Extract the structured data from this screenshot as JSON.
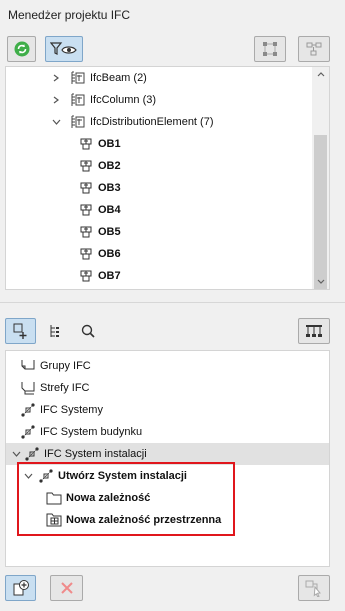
{
  "window": {
    "title": "Menedżer projektu IFC"
  },
  "toolbar_top": {
    "refresh_icon": "refresh-icon",
    "filter_view_icon": "filter-eye-icon",
    "structure_left_icon": "node-structure-icon",
    "structure_right_icon": "node-link-icon"
  },
  "tree_top": {
    "items": [
      {
        "label": "IfcBeam (2)",
        "expanded": false
      },
      {
        "label": "IfcColumn (3)",
        "expanded": false
      },
      {
        "label": "IfcDistributionElement (7)",
        "expanded": true
      }
    ],
    "children": [
      "OB1",
      "OB2",
      "OB3",
      "OB4",
      "OB5",
      "OB6",
      "OB7"
    ]
  },
  "toolbar_middle": {
    "tab_1_icon": "add-element-icon",
    "tab_2_icon": "hierarchy-icon",
    "tab_3_icon": "search-icon",
    "right_icon": "tree-structure-icon"
  },
  "tree_bottom": {
    "items": [
      {
        "label": "Grupy IFC",
        "icon": "group-icon"
      },
      {
        "label": "Strefy IFC",
        "icon": "zone-icon"
      },
      {
        "label": "IFC Systemy",
        "icon": "system-icon"
      },
      {
        "label": "IFC System budynku",
        "icon": "system-icon"
      },
      {
        "label": "IFC System instalacji",
        "icon": "system-icon",
        "expanded": true
      }
    ],
    "highlighted": {
      "parent": "Utwórz System instalacji",
      "children": [
        "Nowa zależność",
        "Nowa zależność przestrzenna"
      ]
    }
  },
  "toolbar_bottom": {
    "add_icon": "add-new-icon",
    "delete_icon": "delete-icon",
    "assign_icon": "assign-icon"
  },
  "colors": {
    "highlight_box": "#e0161c",
    "selected_row": "#e1e1e1",
    "pressed_button": "#c9dff1"
  }
}
